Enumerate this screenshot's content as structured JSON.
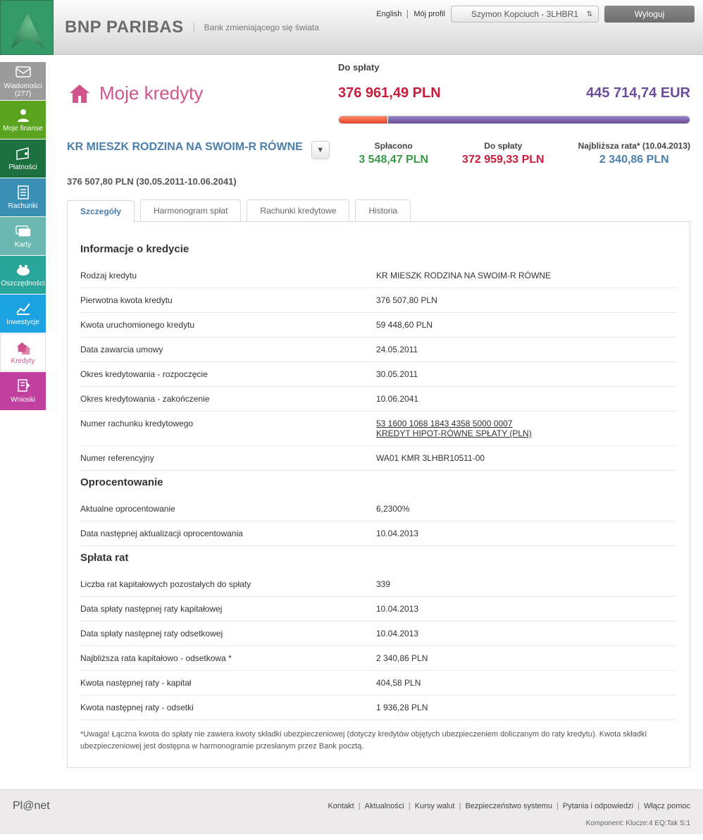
{
  "header": {
    "bank_name": "BNP PARIBAS",
    "bank_tag": "Bank zmieniającego się świata",
    "english": "English",
    "my_profile": "Mój profil",
    "user": "Szymon Kopciuch - 3LHBR1",
    "logout": "Wyloguj"
  },
  "sidebar": [
    {
      "label": "Wiadomości (277)",
      "color": "#9b9b9b"
    },
    {
      "label": "Moje finanse",
      "color": "#5aa31f"
    },
    {
      "label": "Płatności",
      "color": "#1c6f3f"
    },
    {
      "label": "Rachunki",
      "color": "#3a8fb5"
    },
    {
      "label": "Karty",
      "color": "#6bb8b0"
    },
    {
      "label": "Oszczędności",
      "color": "#2aa59a"
    },
    {
      "label": "Inwestycje",
      "color": "#1aa3e0"
    },
    {
      "label": "Kredyty",
      "color": "#ffffff",
      "text": "#d1558d"
    },
    {
      "label": "Wnioski",
      "color": "#c13f9e"
    }
  ],
  "page": {
    "title": "Moje kredyty",
    "to_repay_label": "Do spłaty",
    "amount_pln": "376 961,49 PLN",
    "amount_eur": "445 714,74 EUR"
  },
  "credit": {
    "name": "KR MIESZK RODZINA NA SWOIM-R RÓWNE",
    "sub": "376 507,80 PLN (30.05.2011-10.06.2041)",
    "cols": [
      {
        "label": "Spłacono",
        "value": "3 548,47  PLN",
        "cls": "val-green"
      },
      {
        "label": "Do spłaty",
        "value": "372 959,33  PLN",
        "cls": "val-red"
      },
      {
        "label": "Najbliższa rata* (10.04.2013)",
        "value": "2 340,86  PLN",
        "cls": "val-blue"
      }
    ]
  },
  "tabs": [
    "Szczegóły",
    "Harmonogram spłat",
    "Rachunki kredytowe",
    "Historia"
  ],
  "sections": [
    {
      "title": "Informacje o kredycie",
      "rows": [
        {
          "l": "Rodzaj kredytu",
          "v": "KR MIESZK RODZINA NA SWOIM-R RÓWNE"
        },
        {
          "l": "Pierwotna kwota kredytu",
          "v": "376 507,80  PLN"
        },
        {
          "l": "Kwota uruchomionego kredytu",
          "v": "59 448,60  PLN"
        },
        {
          "l": "Data zawarcia umowy",
          "v": "24.05.2011"
        },
        {
          "l": "Okres kredytowania - rozpoczęcie",
          "v": "30.05.2011"
        },
        {
          "l": "Okres kredytowania - zakończenie",
          "v": "10.06.2041"
        },
        {
          "l": "Numer rachunku kredytowego",
          "v": "53 1600 1068 1843 4358 5000 0007\nKREDYT HIPOT-RÓWNE SPŁATY  (PLN)",
          "link": true
        },
        {
          "l": "Numer referencyjny",
          "v": "WA01 KMR 3LHBR10511-00"
        }
      ]
    },
    {
      "title": "Oprocentowanie",
      "rows": [
        {
          "l": "Aktualne oprocentowanie",
          "v": "6,2300%"
        },
        {
          "l": "Data następnej aktualizacji oprocentowania",
          "v": "10.04.2013"
        }
      ]
    },
    {
      "title": "Spłata rat",
      "rows": [
        {
          "l": "Liczba rat kapitałowych pozostałych do spłaty",
          "v": "339"
        },
        {
          "l": "Data spłaty następnej raty kapitałowej",
          "v": "10.04.2013"
        },
        {
          "l": "Data spłaty następnej raty odsetkowej",
          "v": "10.04.2013"
        },
        {
          "l": "Najbliższa rata kapitałowo - odsetkowa *",
          "v": "2 340,86  PLN"
        },
        {
          "l": "Kwota następnej raty - kapitał",
          "v": "404,58 PLN"
        },
        {
          "l": "Kwota następnej raty - odsetki",
          "v": "1 936,28 PLN"
        }
      ]
    }
  ],
  "note": "*Uwaga! Łączna kwota do spłaty nie zawiera kwoty składki ubezpieczeniowej (dotyczy kredytów objętych ubezpieczeniem doliczanym do raty kredytu). Kwota składki ubezpieczeniowej jest dostępna w harmonogramie przesłanym przez Bank pocztą.",
  "footer": {
    "brand": "Pl@net",
    "links": [
      "Kontakt",
      "Aktualności",
      "Kursy walut",
      "Bezpieczeństwo systemu",
      "Pytania i odpowiedzi",
      "Włącz pomoc"
    ],
    "component": "Komponent: Klucze:4 EQ:Tak S:1"
  }
}
